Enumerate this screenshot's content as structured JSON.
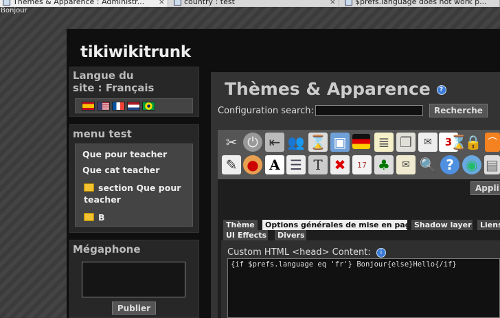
{
  "browser": {
    "tabs": [
      {
        "title": "Thèmes & Apparence : Administr..."
      },
      {
        "title": "country : test"
      },
      {
        "title": "$prefs.language does not work p..."
      }
    ],
    "close_glyph": "×"
  },
  "greeting": "Bonjour",
  "site": {
    "title": "tikiwikitrunk"
  },
  "sidebar": {
    "language": {
      "title": "Langue du site : Français",
      "title_line1": "Langue du",
      "title_line2": "site : Français",
      "flags": [
        {
          "name": "spanish-flag-icon",
          "colors": [
            "#c60b1e",
            "#ffc400",
            "#c60b1e"
          ]
        },
        {
          "name": "us-flag-icon",
          "colors": [
            "#b22234",
            "#ffffff",
            "#3c3b6e"
          ]
        },
        {
          "name": "french-flag-icon",
          "colors": [
            "#0055a4",
            "#ffffff",
            "#ef4135"
          ]
        },
        {
          "name": "dutch-flag-icon",
          "colors": [
            "#ae1c28",
            "#ffffff",
            "#21468b"
          ]
        },
        {
          "name": "brazil-flag-icon",
          "colors": [
            "#009c3b",
            "#ffdf00",
            "#002776"
          ]
        }
      ]
    },
    "menu": {
      "title": "menu test",
      "items": [
        {
          "label": "Que pour teacher"
        },
        {
          "label": "Que cat teacher"
        },
        {
          "label": "section Que pour teacher",
          "line1": "section Que pour",
          "line2": "teacher",
          "icon": "folder-icon"
        },
        {
          "label": "B",
          "icon": "folder-icon"
        }
      ]
    },
    "megaphone": {
      "title": "Mégaphone",
      "button": "Publier"
    }
  },
  "main": {
    "title": "Thèmes & Apparence",
    "config_search": {
      "label": "Configuration search:",
      "value": "",
      "button": "Recherche"
    },
    "icons_row1": [
      "tools-icon",
      "power-icon",
      "logout-door-icon",
      "users-icon",
      "hourglass-icon",
      "image-icon",
      "german-flag-icon",
      "notepad-icon",
      "documents-icon",
      "mail-icon",
      "calendar-icon",
      "hourglass-2-icon",
      "lock-icon",
      "rss-icon"
    ],
    "icons_row2": [
      "edit-document-icon",
      "palette-icon",
      "font-icon",
      "list-icon",
      "text-block-icon",
      "delete-icon",
      "calendar-17-icon",
      "tree-icon",
      "letter-icon",
      "search-icon",
      "help-icon",
      "globe-icon",
      "package-icon"
    ],
    "apply_button": "Appli",
    "tabs": [
      {
        "label": "Thème"
      },
      {
        "label": "Options générales de mise en page",
        "active": true
      },
      {
        "label": "Shadow layer"
      },
      {
        "label": "Liens"
      },
      {
        "label": "UI Effects"
      },
      {
        "label": "Divers"
      }
    ],
    "custom_head": {
      "label": "Custom HTML <head> Content:",
      "value": "{if $prefs.language eq 'fr'} Bonjour{else}Hello{/if}"
    }
  }
}
